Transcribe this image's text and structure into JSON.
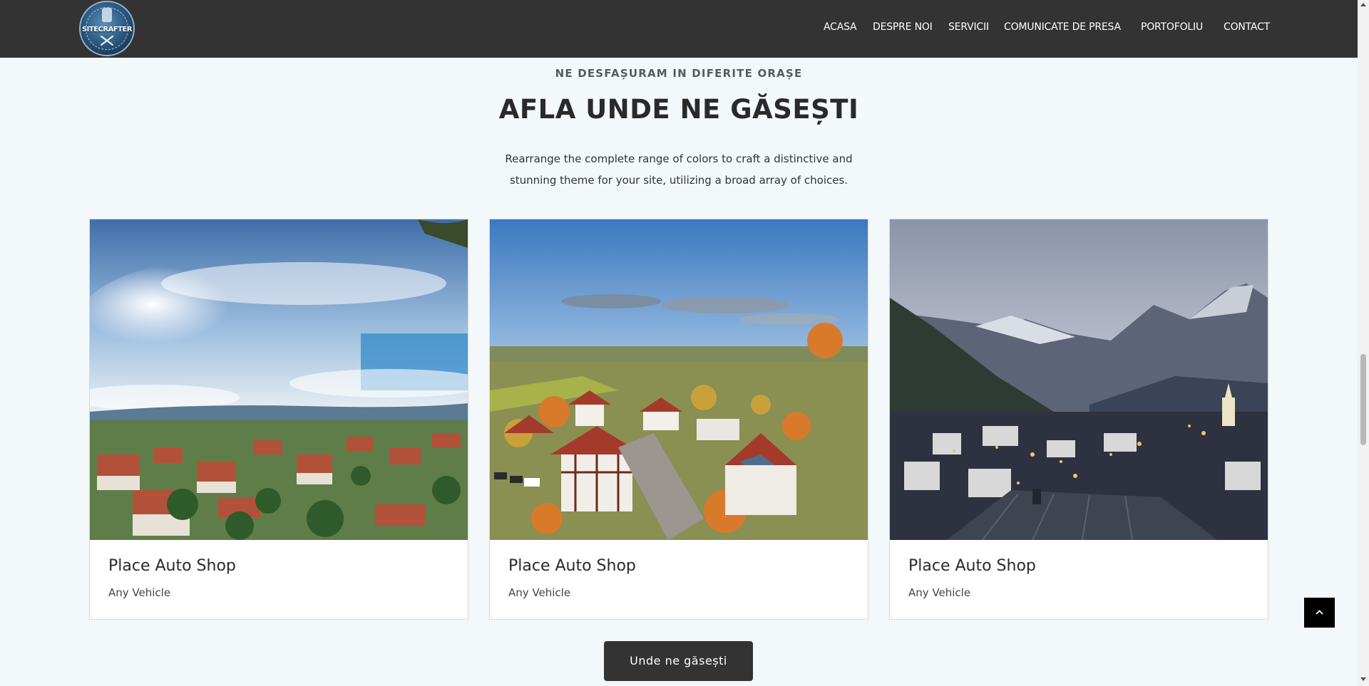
{
  "header": {
    "logo_text": "SITECRAFTER",
    "nav": [
      {
        "label": "ACASA"
      },
      {
        "label": "DESPRE NOI"
      },
      {
        "label": "SERVICII"
      },
      {
        "label": "COMUNICATE DE PRESA"
      },
      {
        "label": "PORTOFOLIU"
      },
      {
        "label": "CONTACT"
      }
    ]
  },
  "section": {
    "eyebrow": "NE DESFAȘURAM IN DIFERITE ORAȘE",
    "title": "AFLA UNDE NE GĂSEȘTI",
    "subtitle_line1": "Rearrange the complete range of colors to craft a distinctive and",
    "subtitle_line2": "stunning theme for your site, utilizing a broad array of choices."
  },
  "cards": [
    {
      "title": "Place Auto Shop",
      "subtitle": "Any Vehicle",
      "image": "town-blue-sky-photo"
    },
    {
      "title": "Place Auto Shop",
      "subtitle": "Any Vehicle",
      "image": "autumn-village-photo"
    },
    {
      "title": "Place Auto Shop",
      "subtitle": "Any Vehicle",
      "image": "mountain-town-dusk-photo"
    }
  ],
  "cta": {
    "label": "Unde ne găsești"
  },
  "icons": {
    "back_to_top": "chevron-up-icon"
  },
  "colors": {
    "header_bg": "#333333",
    "page_bg": "#f3f8fa",
    "button_bg": "#333333",
    "back_to_top_bg": "#000000"
  }
}
